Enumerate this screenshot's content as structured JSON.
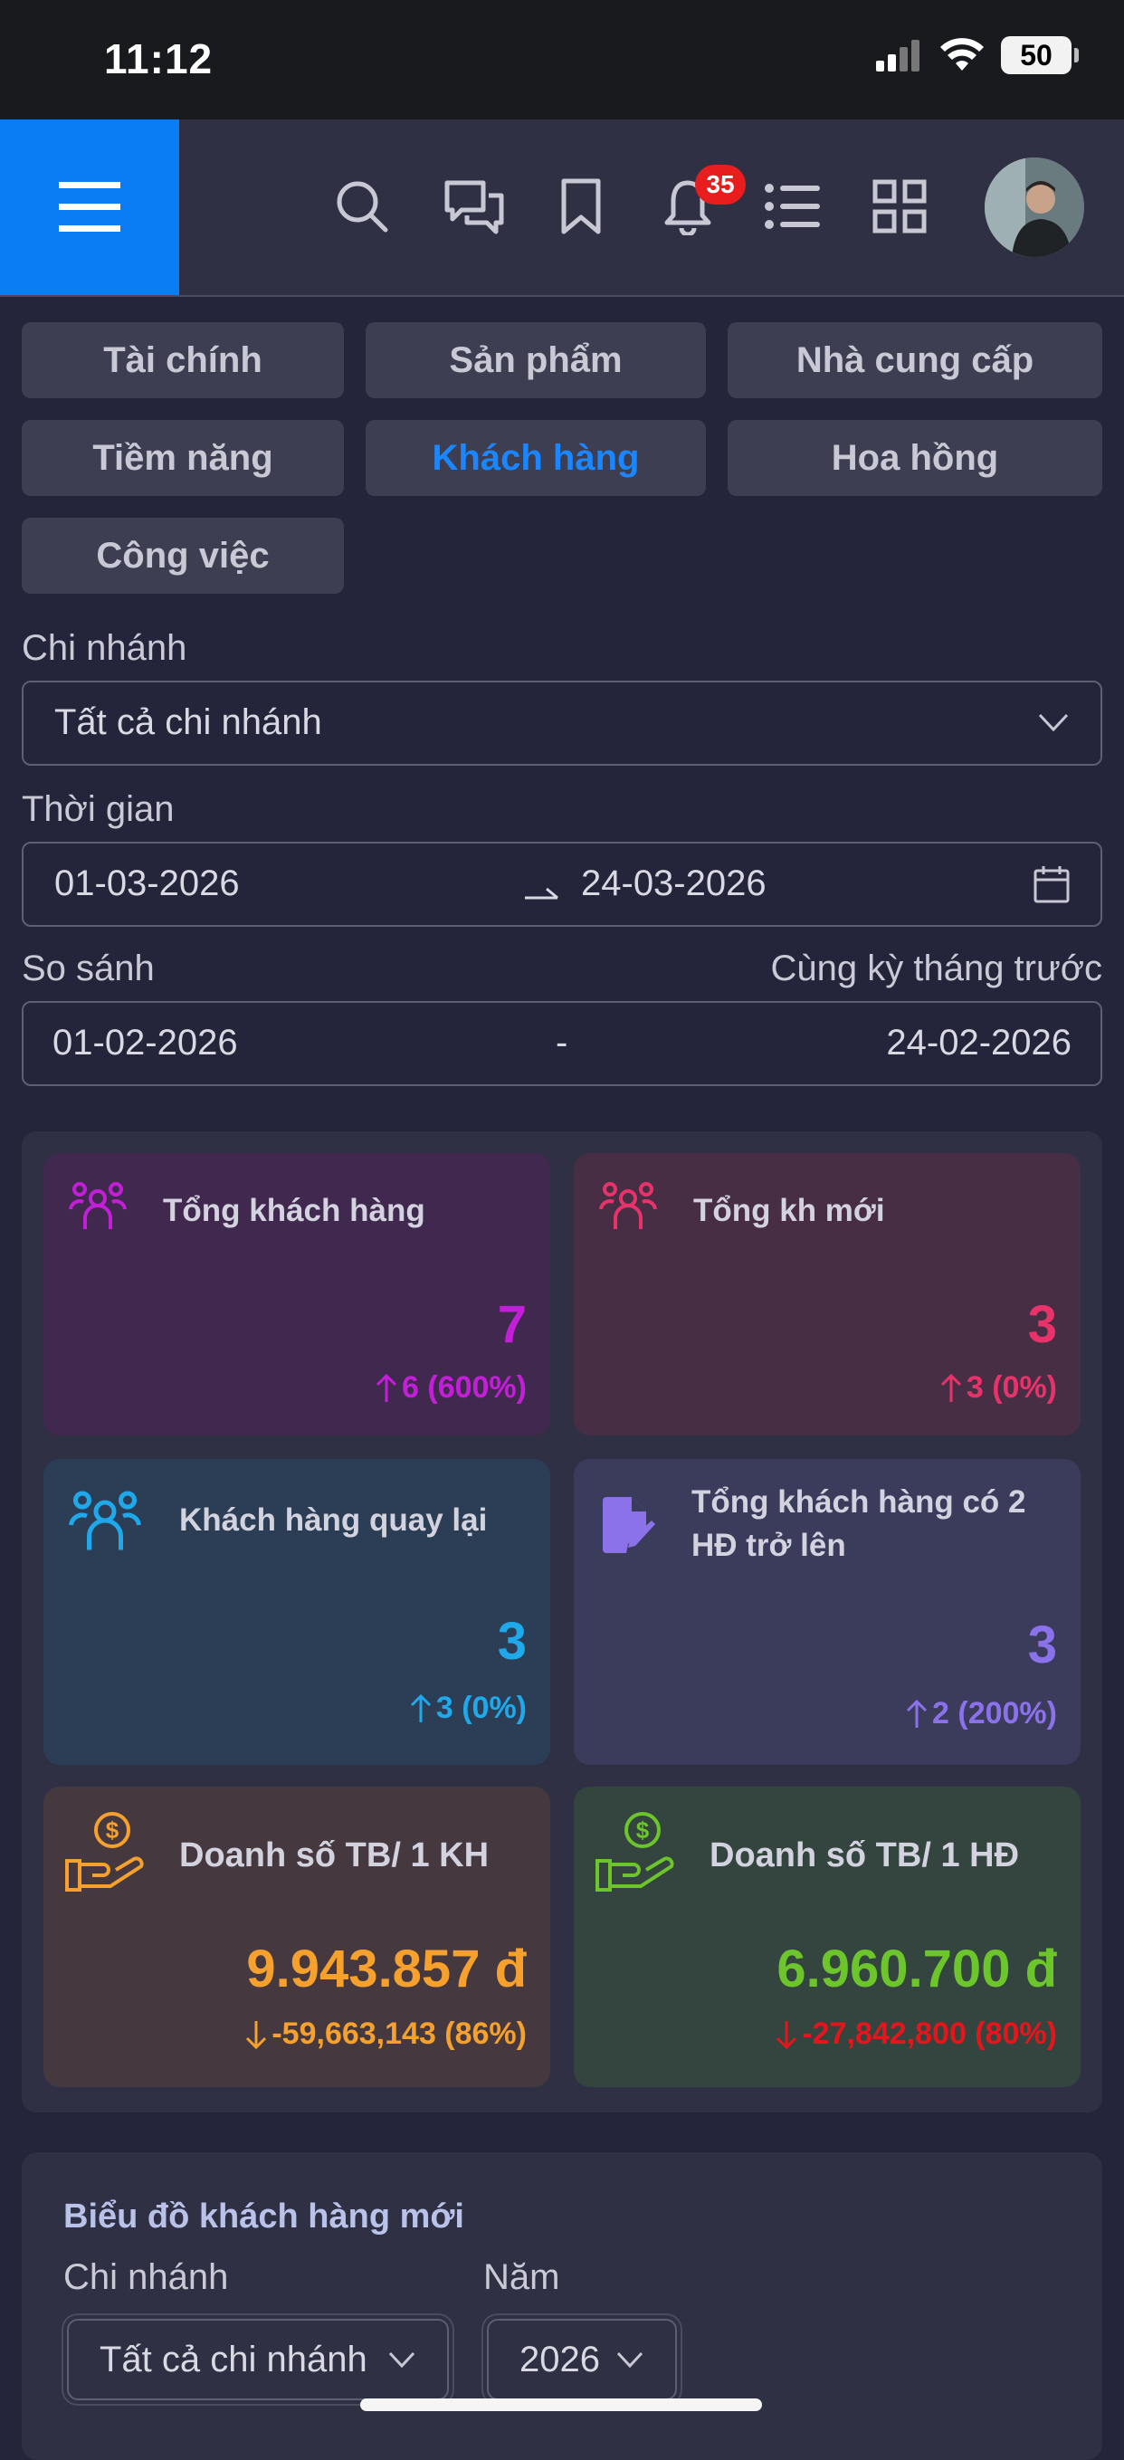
{
  "status_bar": {
    "time": "11:12",
    "battery": "50"
  },
  "header": {
    "notification_count": "35",
    "icons": [
      "menu-icon",
      "search-icon",
      "chat-icon",
      "bookmark-icon",
      "bell-icon",
      "list-icon",
      "grid-icon",
      "avatar"
    ]
  },
  "tabs": [
    {
      "label": "Tài chính"
    },
    {
      "label": "Sản phẩm"
    },
    {
      "label": "Nhà cung cấp"
    },
    {
      "label": "Tiềm năng"
    },
    {
      "label": "Khách hàng",
      "active": true
    },
    {
      "label": "Hoa hồng"
    },
    {
      "label": "Công việc"
    }
  ],
  "filters": {
    "branch_label": "Chi nhánh",
    "branch_value": "Tất cả chi nhánh",
    "time_label": "Thời gian",
    "time_from": "01-03-2026",
    "time_to": "24-03-2026",
    "compare_label": "So sánh",
    "compare_mode": "Cùng kỳ tháng trước",
    "compare_from": "01-02-2026",
    "compare_sep": "-",
    "compare_to": "24-02-2026"
  },
  "stats": [
    {
      "title": "Tổng khách hàng",
      "value": "7",
      "change": "6 (600%)",
      "direction": "up",
      "color": "#c31fd8",
      "bg": "#41284f"
    },
    {
      "title": "Tổng kh mới",
      "value": "3",
      "change": "3 (0%)",
      "direction": "up",
      "color": "#e8336a",
      "bg": "#472e44"
    },
    {
      "title": "Khách hàng quay lại",
      "value": "3",
      "change": "3 (0%)",
      "direction": "up",
      "color": "#1fa8ea",
      "bg": "#2b3e56"
    },
    {
      "title": "Tổng khách hàng có 2 HĐ trở lên",
      "value": "3",
      "change": "2 (200%)",
      "direction": "up",
      "color": "#8b72ea",
      "bg": "#3b3b5c"
    },
    {
      "title": "Doanh số TB/ 1 KH",
      "value": "9.943.857 đ",
      "change": "-59,663,143 (86%)",
      "direction": "down",
      "color": "#f6a02d",
      "change_color": "#f6a02d",
      "bg": "#45393f"
    },
    {
      "title": "Doanh số TB/ 1 HĐ",
      "value": "6.960.700 đ",
      "change": "-27,842,800 (80%)",
      "direction": "down",
      "color": "#6cc52a",
      "change_color": "#e5161b",
      "bg": "#34443e"
    }
  ],
  "chart_section": {
    "title": "Biểu đồ khách hàng mới",
    "branch_label": "Chi nhánh",
    "branch_value": "Tất cả chi nhánh",
    "year_label": "Năm",
    "year_value": "2026"
  }
}
